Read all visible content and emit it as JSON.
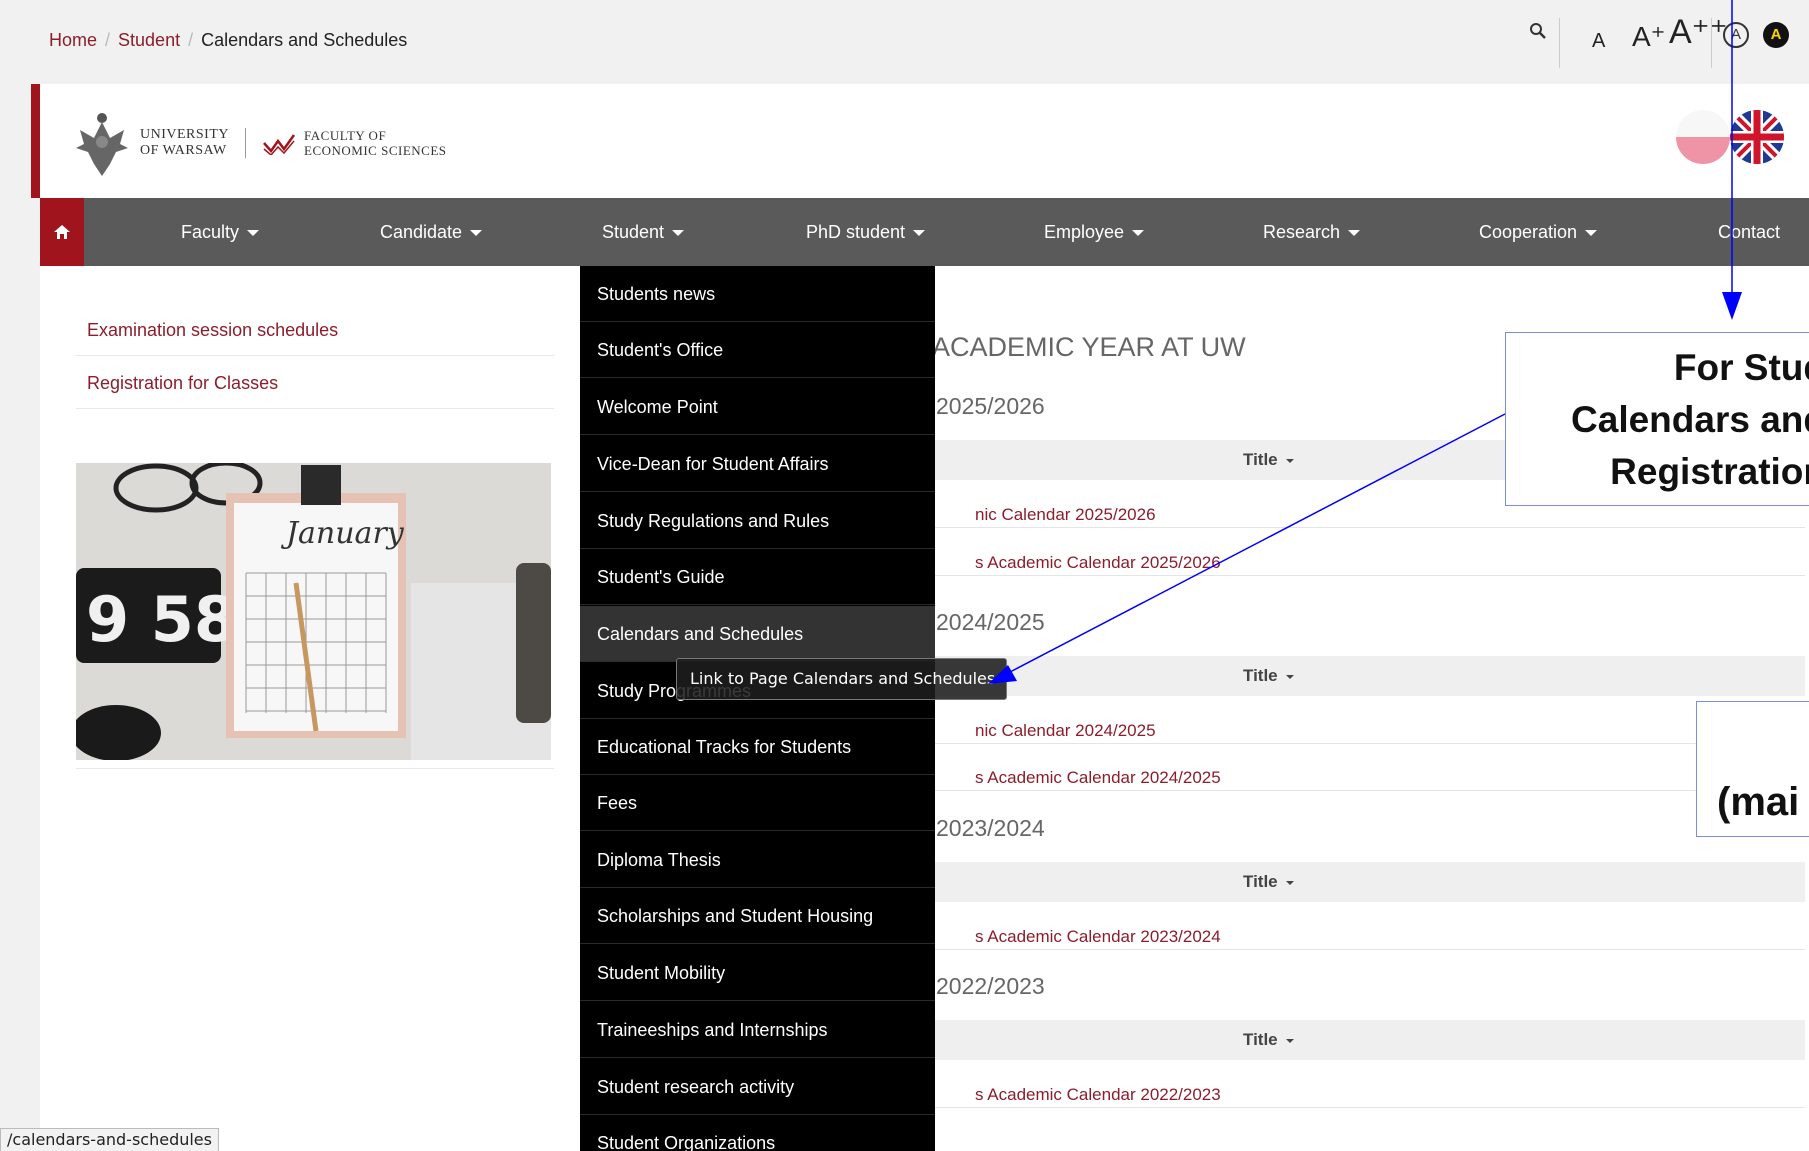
{
  "breadcrumb": {
    "home": "Home",
    "student": "Student",
    "current": "Calendars and Schedules"
  },
  "accessibility": {
    "a_small": "A",
    "a_plus": "A⁺",
    "a_plusplus": "A⁺⁺",
    "contrast_normal": "A",
    "contrast_high": "A"
  },
  "logo": {
    "uw_line1": "UNIVERSITY",
    "uw_line2": "OF WARSAW",
    "wne_line1": "FACULTY OF",
    "wne_line2": "ECONOMIC SCIENCES"
  },
  "nav": {
    "items": [
      "Faculty",
      "Candidate",
      "Student",
      "PhD student",
      "Employee",
      "Research",
      "Cooperation",
      "Contact"
    ]
  },
  "sidebar": {
    "links": [
      "Examination session schedules",
      "Registration for Classes"
    ],
    "photo": {
      "calendar_word": "January",
      "clock": "9 58"
    }
  },
  "main": {
    "heading": "ACADEMIC YEAR AT UW",
    "years": [
      "2025/2026",
      "2024/2025",
      "2023/2024",
      "2022/2023"
    ],
    "column_title": "Title",
    "rows_2025": [
      "nic Calendar 2025/2026",
      "s Academic Calendar 2025/2026"
    ],
    "rows_2024": [
      "nic Calendar 2024/2025",
      "s Academic Calendar 2024/2025"
    ],
    "rows_2023": [
      "s Academic Calendar 2023/2024"
    ],
    "rows_2022": [
      "s Academic Calendar 2022/2023"
    ]
  },
  "dropdown": {
    "items": [
      "Students news",
      "Student's Office",
      "Welcome Point",
      "Vice-Dean for Student Affairs",
      "Study Regulations and Rules",
      "Student's Guide",
      "Calendars and Schedules",
      "Study Programmes",
      "Educational Tracks for Students",
      "Fees",
      "Diploma Thesis",
      "Scholarships and Student Housing",
      "Student Mobility",
      "Traineeships and Internships",
      "Student research activity",
      "Student Organizations"
    ]
  },
  "tooltip": "Link to Page Calendars and Schedules",
  "callout": {
    "line1": "For Stud",
    "line2": "Calendars and",
    "line3": "Registration"
  },
  "callout2": {
    "line1": "(mai"
  },
  "status_url": "/calendars-and-schedules",
  "colors": {
    "brand": "#a0141d",
    "link": "#8c1d2c",
    "nav": "#5a5a5a",
    "annotation": "#0000ff"
  }
}
